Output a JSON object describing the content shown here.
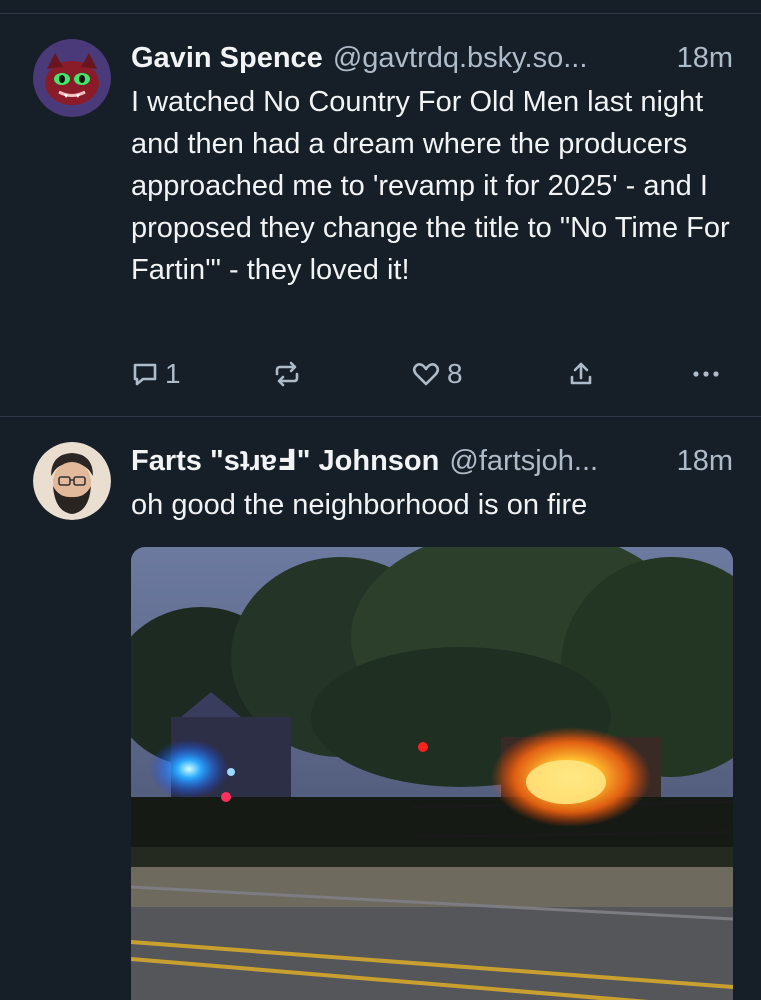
{
  "posts": [
    {
      "author": "Gavin Spence",
      "handle": "@gavtrdq.bsky.so...",
      "time": "18m",
      "text": "I watched No Country For Old Men last night and then had a dream where the producers approached me to 'revamp it for 2025' - and I proposed they change the title to \"No Time For Fartin'\" - they loved it!",
      "replies": "1",
      "likes": "8",
      "icons": {
        "reply": "speech-bubble-icon",
        "repost": "repost-arrows-icon",
        "like": "heart-icon",
        "share": "share-upload-icon",
        "more": "ellipsis-icon"
      }
    },
    {
      "author": "Farts \"sʇɹɐℲ\" Johnson",
      "handle": "@fartsjoh...",
      "time": "18m",
      "text": "oh good the neighborhood is on fire"
    }
  ],
  "colors": {
    "background": "#161e27",
    "text": "#f1f3f5",
    "muted": "#aebbc9",
    "divider": "#2e3a47"
  }
}
